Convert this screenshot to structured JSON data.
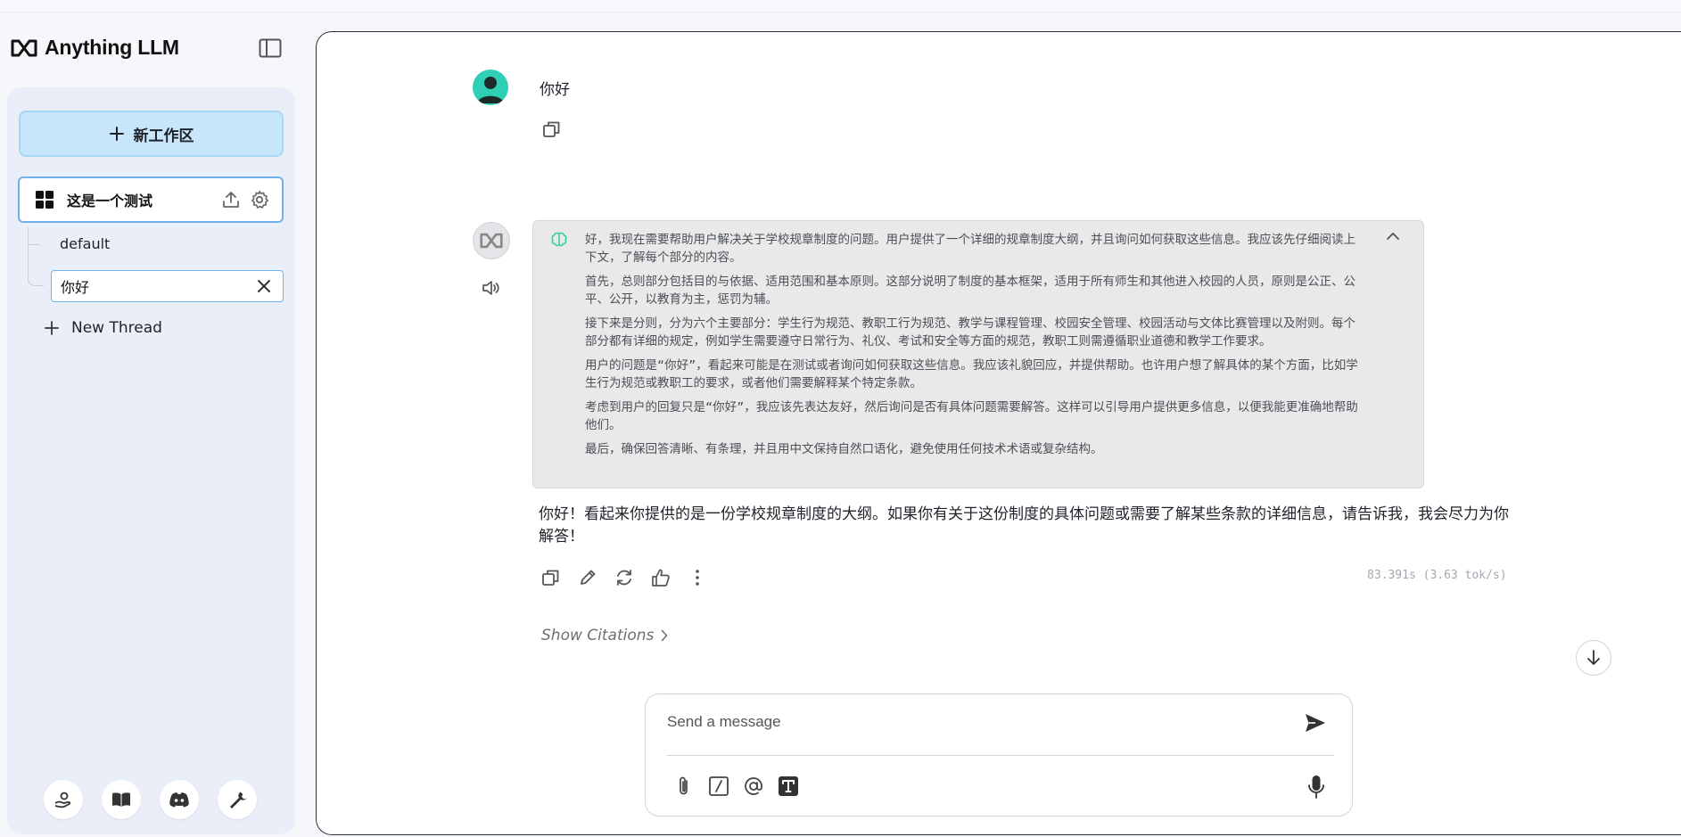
{
  "app": {
    "logo_text": "Anything LLM"
  },
  "sidebar": {
    "new_workspace_label": "新工作区",
    "workspace": {
      "name": "这是一个测试"
    },
    "threads": [
      {
        "label": "default"
      },
      {
        "label": "你好"
      }
    ],
    "new_thread_label": "New Thread",
    "footer_icons": [
      "support-icon",
      "docs-book-icon",
      "discord-icon",
      "settings-wrench-icon"
    ]
  },
  "chat": {
    "user_message": "你好",
    "thinking": [
      "好，我现在需要帮助用户解决关于学校规章制度的问题。用户提供了一个详细的规章制度大纲，并且询问如何获取这些信息。我应该先仔细阅读上下文，了解每个部分的内容。",
      "首先，总则部分包括目的与依据、适用范围和基本原则。这部分说明了制度的基本框架，适用于所有师生和其他进入校园的人员，原则是公正、公平、公开，以教育为主，惩罚为辅。",
      "接下来是分则，分为六个主要部分：学生行为规范、教职工行为规范、教学与课程管理、校园安全管理、校园活动与文体比赛管理以及附则。每个部分都有详细的规定，例如学生需要遵守日常行为、礼仪、考试和安全等方面的规范，教职工则需遵循职业道德和教学工作要求。",
      "用户的问题是“你好”，看起来可能是在测试或者询问如何获取这些信息。我应该礼貌回应，并提供帮助。也许用户想了解具体的某个方面，比如学生行为规范或教职工的要求，或者他们需要解释某个特定条款。",
      "考虑到用户的回复只是“你好”，我应该先表达友好，然后询问是否有具体问题需要解答。这样可以引导用户提供更多信息，以便我能更准确地帮助他们。",
      "最后，确保回答清晰、有条理，并且用中文保持自然口语化，避免使用任何技术术语或复杂结构。"
    ],
    "assistant_answer": "你好！看起来你提供的是一份学校规章制度的大纲。如果你有关于这份制度的具体问题或需要了解某些条款的详细信息，请告诉我，我会尽力为你解答！",
    "speed": "83.391s (3.63 tok/s)",
    "show_citations_label": "Show Citations"
  },
  "composer": {
    "placeholder": "Send a message"
  },
  "colors": {
    "accent_button": "#c7e6fb",
    "active_border": "#6fb2ea",
    "user_avatar": "#2ecfb5",
    "thinking_bg": "#e9e9ea"
  }
}
